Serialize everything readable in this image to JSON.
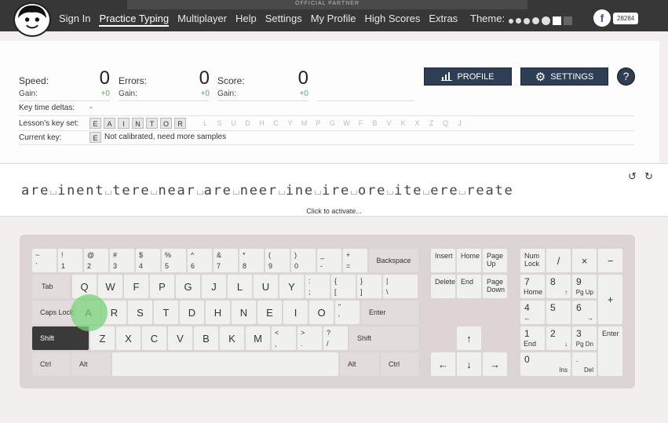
{
  "nav": {
    "banner": "OFFICIAL PARTNER",
    "items": [
      "Sign In",
      "Practice Typing",
      "Multiplayer",
      "Help",
      "Settings",
      "My Profile",
      "High Scores",
      "Extras"
    ],
    "theme_label": "Theme:",
    "fb_count": "28284"
  },
  "stats": {
    "speed_label": "Speed:",
    "speed": "0",
    "speed_gain": "+0",
    "errors_label": "Errors:",
    "errors": "0",
    "errors_gain": "+0",
    "score_label": "Score:",
    "score": "0",
    "score_gain": "+0",
    "gain_label": "Gain:"
  },
  "rows": {
    "deltas_label": "Key time deltas:",
    "deltas_value": "-",
    "keyset_label": "Lesson's key set:",
    "keyset_on": [
      "E",
      "A",
      "I",
      "N",
      "T",
      "O",
      "R"
    ],
    "keyset_off": [
      "L",
      "S",
      "U",
      "D",
      "H",
      "C",
      "Y",
      "M",
      "P",
      "G",
      "W",
      "F",
      "B",
      "V",
      "K",
      "X",
      "Z",
      "Q",
      "J"
    ],
    "current_label": "Current key:",
    "current_key": "E",
    "current_note": "Not calibrated, need more samples"
  },
  "buttons": {
    "profile": "PROFILE",
    "settings": "SETTINGS",
    "help": "?"
  },
  "lesson": {
    "text": "are inent tere near are neer ine ire ore ite ere reate",
    "activate": "Click to activate..."
  },
  "keyboard": {
    "row1": [
      [
        "~",
        "`"
      ],
      [
        "!",
        "1"
      ],
      [
        "@",
        "2"
      ],
      [
        "#",
        "3"
      ],
      [
        "$",
        "4"
      ],
      [
        "%",
        "5"
      ],
      [
        "^",
        "6"
      ],
      [
        "&",
        "7"
      ],
      [
        "*",
        "8"
      ],
      [
        "(",
        "9"
      ],
      [
        ")",
        "0"
      ],
      [
        "_",
        "-"
      ],
      [
        "+",
        "="
      ]
    ],
    "backspace": "Backspace",
    "tab": "Tab",
    "row2": [
      "Q",
      "W",
      "F",
      "P",
      "G",
      "J",
      "L",
      "U",
      "Y"
    ],
    "row2_sym": [
      [
        ":",
        ";"
      ],
      [
        "{",
        "["
      ],
      [
        "}",
        "]"
      ],
      [
        "|",
        "\\"
      ]
    ],
    "caps": "Caps Lock",
    "row3": [
      "A",
      "R",
      "S",
      "T",
      "D",
      "H",
      "N",
      "E",
      "I",
      "O"
    ],
    "row3_sym": [
      [
        "\"",
        "'"
      ]
    ],
    "enter": "Enter",
    "shift": "Shift",
    "row4": [
      "Z",
      "X",
      "C",
      "V",
      "B",
      "K",
      "M"
    ],
    "row4_sym": [
      [
        "<",
        ","
      ],
      [
        ">",
        "."
      ],
      [
        "?",
        "/"
      ]
    ],
    "ctrl": "Ctrl",
    "alt": "Alt",
    "nav_keys": [
      [
        "Insert"
      ],
      [
        "Home"
      ],
      [
        "Page",
        "Up"
      ],
      [
        "Delete"
      ],
      [
        "End"
      ],
      [
        "Page",
        "Down"
      ]
    ],
    "arrows": {
      "up": "↑",
      "left": "←",
      "down": "↓",
      "right": "→"
    },
    "numpad": {
      "numlock": [
        "Num",
        "Lock"
      ],
      "div": "/",
      "mul": "×",
      "minus": "−",
      "plus": "+",
      "n7": [
        "7",
        "Home"
      ],
      "n8": [
        "8",
        "↑"
      ],
      "n9": [
        "9",
        "Pg Up"
      ],
      "n4": [
        "4",
        "←"
      ],
      "n5": [
        "5",
        ""
      ],
      "n6": [
        "6",
        "→"
      ],
      "n1": [
        "1",
        "End"
      ],
      "n2": [
        "2",
        "↓"
      ],
      "n3": [
        "3",
        "Pg Dn"
      ],
      "n0": [
        "0",
        "Ins"
      ],
      "dot": [
        ".",
        "Del"
      ],
      "enter": "Enter"
    }
  }
}
